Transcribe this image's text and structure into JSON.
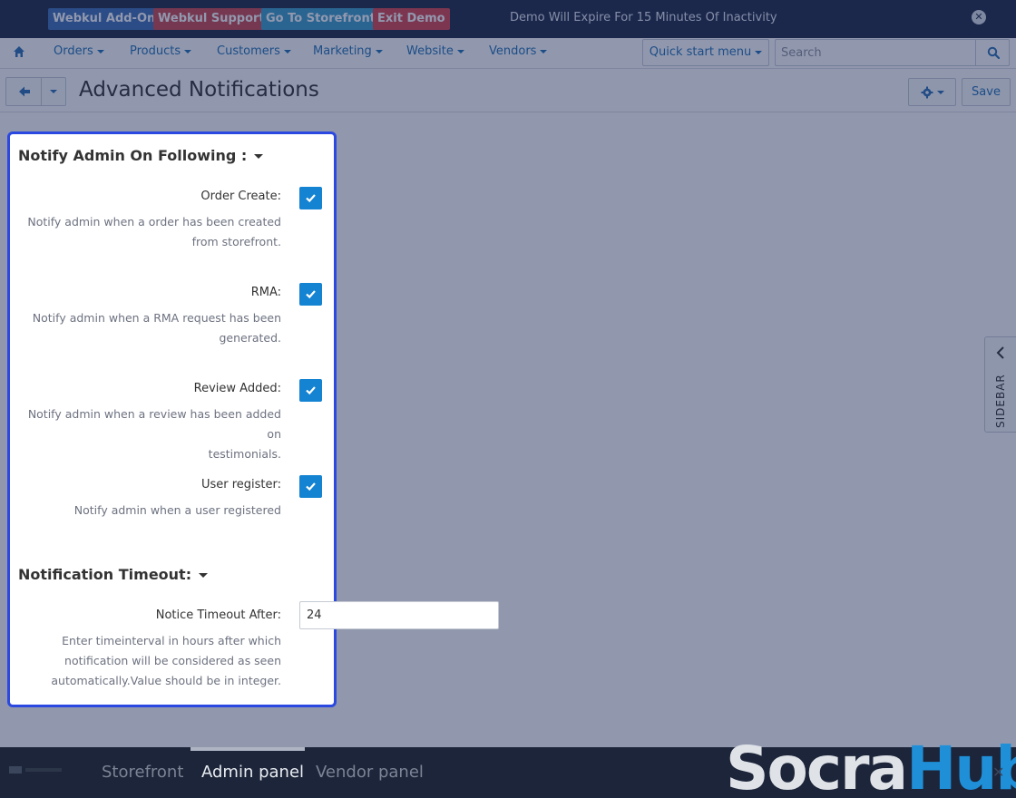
{
  "demo_bar": {
    "buttons": [
      "Webkul Add-On",
      "Webkul Support",
      "Go To Storefront",
      "Exit Demo"
    ],
    "message": "Demo Will Expire For 15 Minutes Of Inactivity",
    "close_icon": "close-circle-icon"
  },
  "nav": {
    "home_icon": "home-icon",
    "items": [
      "Orders",
      "Products",
      "Customers",
      "Marketing",
      "Website",
      "Vendors"
    ],
    "quick_start": "Quick start menu",
    "search_placeholder": "Search",
    "search_icon": "search-icon"
  },
  "header": {
    "title": "Advanced Notifications",
    "back_icon": "arrow-left-icon",
    "gear_icon": "gear-icon",
    "save_label": "Save"
  },
  "sidebar": {
    "label": "SIDEBAR",
    "icon": "chevron-left-icon"
  },
  "panel": {
    "section1_title": "Notify Admin On Following :",
    "options": [
      {
        "label": "Order Create:",
        "desc_lines": [
          "Notify admin when a order has been created",
          "from storefront."
        ],
        "checked": true
      },
      {
        "label": "RMA:",
        "desc_lines": [
          "Notify admin when a RMA request has been",
          "generated."
        ],
        "checked": true
      },
      {
        "label": "Review Added:",
        "desc_lines": [
          "Notify admin when a review has been added on",
          "testimonials."
        ],
        "checked": true
      },
      {
        "label": "User register:",
        "desc_lines": [
          "Notify admin when a user registered"
        ],
        "checked": true
      }
    ],
    "section2_title": "Notification Timeout:",
    "timeout_label": "Notice Timeout After:",
    "timeout_value": "24",
    "timeout_desc_lines": [
      "Enter timeinterval in hours after which",
      "notification will be considered as seen",
      "automatically.Value should be in integer."
    ]
  },
  "bottom_bar": {
    "tabs": [
      "Storefront",
      "Admin panel",
      "Vendor panel"
    ],
    "active_tab": "Admin panel",
    "brand_part1": "Socra",
    "brand_part2": "Hub"
  },
  "colors": {
    "demo_bar_bg": "#1d2a44",
    "link_blue": "#1f6fb2",
    "checkbox_blue": "#1383d2",
    "highlight_border": "#2b49e0",
    "overlay": "rgba(25,40,85,0.48)"
  }
}
